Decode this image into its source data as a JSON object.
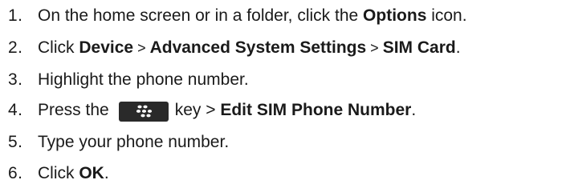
{
  "steps": [
    {
      "number": "1.",
      "parts": [
        "On the home screen or in a folder, click the ",
        "Options",
        " icon."
      ]
    },
    {
      "number": "2.",
      "parts": [
        "Click ",
        "Device",
        ">",
        "Advanced System Settings",
        ">",
        "SIM Card",
        "."
      ]
    },
    {
      "number": "3.",
      "parts": [
        "Highlight the phone number."
      ]
    },
    {
      "number": "4.",
      "parts": [
        "Press the",
        "key >",
        "Edit SIM Phone Number",
        "."
      ],
      "key_icon": "blackberry-menu-key-icon"
    },
    {
      "number": "5.",
      "parts": [
        "Type your phone number."
      ]
    },
    {
      "number": "6.",
      "parts": [
        "Click ",
        "OK",
        "."
      ]
    }
  ],
  "colors": {
    "text": "#1a1a1a",
    "key_background": "#2a2a2a",
    "key_glyph": "#ffffff"
  }
}
